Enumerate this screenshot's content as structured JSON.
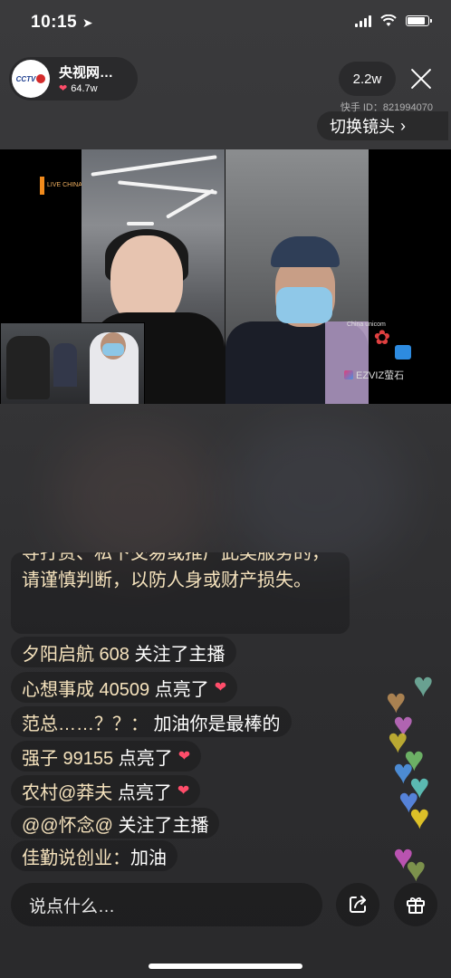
{
  "status_bar": {
    "time": "10:15"
  },
  "header": {
    "anchor_name": "央视网…",
    "anchor_likes": "64.7w",
    "viewers": "2.2w",
    "kuaishou_id": "快手 ID：821994070",
    "switch_camera": "切换镜头"
  },
  "video": {
    "livechina_label": "LIVE CHINA",
    "unicom_label": "China unicom",
    "ezviz_label": "EZVIZ萤石"
  },
  "chat": {
    "notice": "导打赏、私下交易或推广此类服务的，请谨慎判断，以防人身或财产损失。",
    "comments": [
      {
        "user": "夕阳启航 608",
        "msg": "关注了主播",
        "heart": false
      },
      {
        "user": "心想事成 40509",
        "msg": "点亮了",
        "heart": true
      },
      {
        "user": "范总……？？：",
        "msg": "加油你是最棒的",
        "heart": false
      },
      {
        "user": "强子 99155",
        "msg": "点亮了",
        "heart": true
      },
      {
        "user": "农村@莽夫",
        "msg": "点亮了",
        "heart": true
      },
      {
        "user": "@@怀念@",
        "msg": "关注了主播",
        "heart": false
      },
      {
        "user": "佳勤说创业：",
        "msg": "加油",
        "heart": false
      }
    ]
  },
  "bottom": {
    "input_placeholder": "说点什么…",
    "share_icon": "share-icon",
    "gift_icon": "gift-icon"
  },
  "colors": {
    "username": "#f6e3bd",
    "heart": "#ff4d6a"
  }
}
